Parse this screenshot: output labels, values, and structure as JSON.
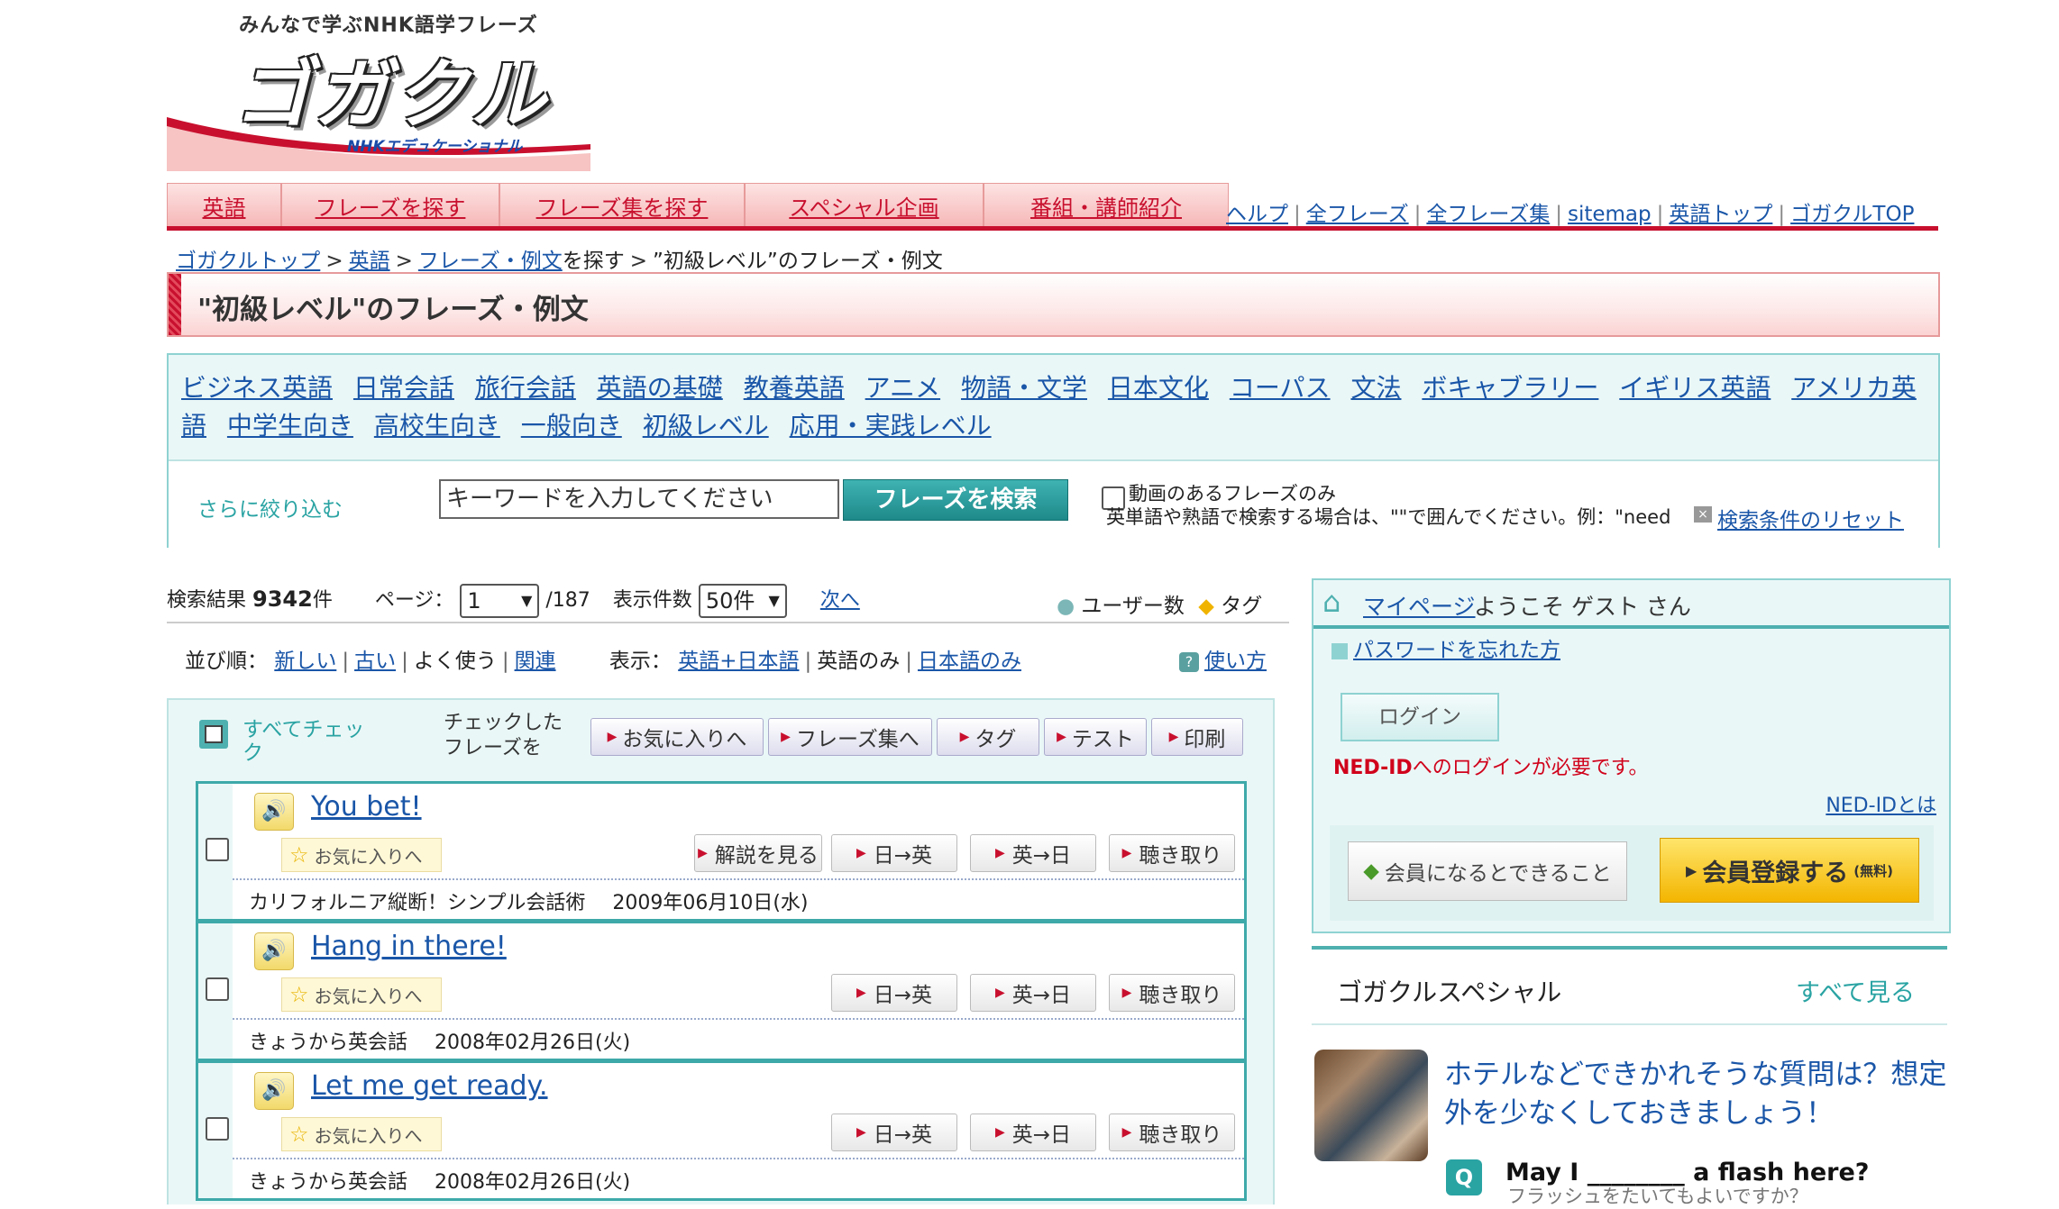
{
  "header": {
    "tagline": "みんなで学ぶNHK語学フレーズ",
    "brand": "ゴガクル",
    "brand_sub": "NHKエデュケーショナル"
  },
  "nav": {
    "tabs": [
      "英語",
      "フレーズを探す",
      "フレーズ集を探す",
      "スペシャル企画",
      "番組・講師紹介"
    ],
    "util_links": [
      "ヘルプ",
      "全フレーズ",
      "全フレーズ集",
      "sitemap",
      "英語トップ",
      "ゴガクルTOP"
    ]
  },
  "breadcrumb": {
    "items": [
      "ゴガクルトップ",
      "英語",
      "フレーズ・例文"
    ],
    "suffix": "を探す",
    "current": "”初級レベル”のフレーズ・例文"
  },
  "page_title": "\"初級レベル\"のフレーズ・例文",
  "categories": [
    "ビジネス英語",
    "日常会話",
    "旅行会話",
    "英語の基礎",
    "教養英語",
    "アニメ",
    "物語・文学",
    "日本文化",
    "コーパス",
    "文法",
    "ボキャブラリー",
    "イギリス英語",
    "アメリカ英語",
    "中学生向き",
    "高校生向き",
    "一般向き",
    "初級レベル",
    "応用・実践レベル"
  ],
  "refine": {
    "label": "さらに絞り込む",
    "keyword_placeholder": "キーワードを入力してください",
    "search_button": "フレーズを検索",
    "video_only_label": "動画のあるフレーズのみ",
    "note": "英単語や熟語で検索する場合は、\"\"で囲んでください。例：\"need",
    "reset": "検索条件のリセット"
  },
  "results_info": {
    "label": "検索結果",
    "count": "9342",
    "count_unit": "件",
    "page_label": "ページ：",
    "page_value": "1",
    "page_total": "/187",
    "per_page_label": "表示件数",
    "per_page_value": "50件",
    "next": "次へ",
    "user_count": "ユーザー数",
    "tag": "タグ"
  },
  "sort": {
    "label": "並び順：",
    "options": [
      "新しい",
      "古い",
      "よく使う",
      "関連"
    ],
    "display_label": "表示：",
    "display_options": [
      "英語+日本語",
      "英語のみ",
      "日本語のみ"
    ],
    "howto": "使い方"
  },
  "checkbar": {
    "all_check": "すべてチェック",
    "checked_label": "チェックした\nフレーズを",
    "actions": [
      "お気に入りへ",
      "フレーズ集へ",
      "タグ",
      "テスト",
      "印刷"
    ]
  },
  "item_buttons": {
    "favorite": "お気に入りへ",
    "commentary": "解説を見る",
    "ja_en": "日→英",
    "en_ja": "英→日",
    "listening": "聴き取り"
  },
  "results": [
    {
      "phrase": "You bet!",
      "program": "カリフォルニア縦断！シンプル会話術",
      "date": "2009年06月10日(水)",
      "has_commentary": true
    },
    {
      "phrase": "Hang in there!",
      "program": "きょうから英会話",
      "date": "2008年02月26日(火)",
      "has_commentary": false
    },
    {
      "phrase": "Let me get ready.",
      "program": "きょうから英会話",
      "date": "2008年02月26日(火)",
      "has_commentary": false
    }
  ],
  "sidebar": {
    "mypage": "マイページ",
    "welcome": "ようこそ ゲスト さん",
    "forgot_password": "パスワードを忘れた方",
    "login": "ログイン",
    "need_login_bold": "NED-ID",
    "need_login_rest": "へのログインが必要です。",
    "nedid_about": "NED-IDとは",
    "benefit": "会員になるとできること",
    "register": "会員登録する",
    "register_free": "(無料)"
  },
  "special": {
    "title": "ゴガクルスペシャル",
    "see_all": "すべて見る",
    "question": "ホテルなどできかれそうな質問は？想定外を少なくしておきましょう！",
    "q_badge": "Q",
    "q_phrase": "May I ________ a flash here?",
    "q_translation": "フラッシュをたいてもよいですか？"
  },
  "colors": {
    "brand_red": "#c8102e",
    "teal": "#4fb0b0",
    "link_blue": "#1a56a8"
  }
}
